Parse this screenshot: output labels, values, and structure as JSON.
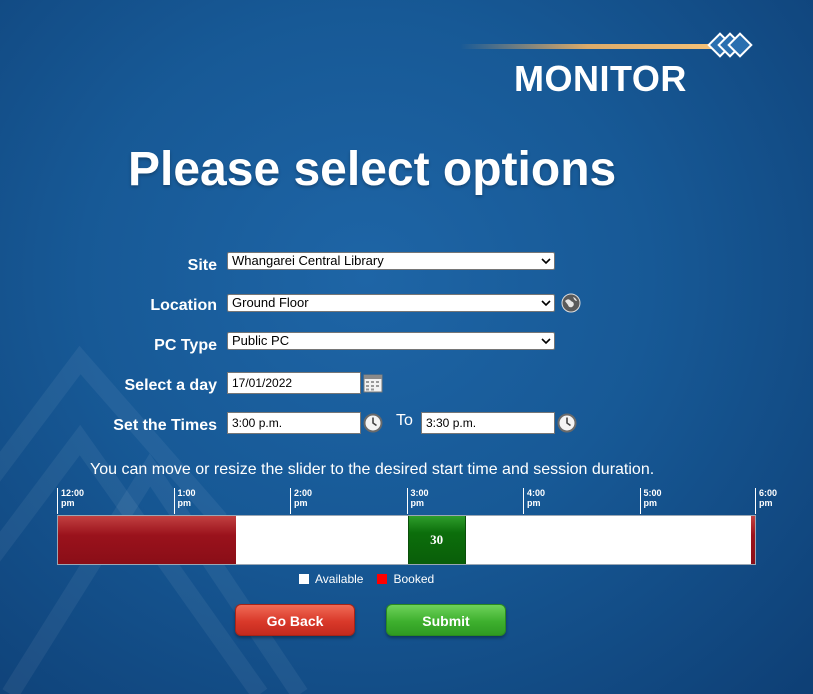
{
  "brand": {
    "logo_text": "MONITOR"
  },
  "page_title": "Please select options",
  "form": {
    "site": {
      "label": "Site",
      "value": "Whangarei Central Library"
    },
    "location": {
      "label": "Location",
      "value": "Ground Floor"
    },
    "pc_type": {
      "label": "PC Type",
      "value": "Public PC"
    },
    "day": {
      "label": "Select a day",
      "value": "17/01/2022"
    },
    "times": {
      "label": "Set the Times",
      "start": "3:00 p.m.",
      "to_label": "To",
      "end": "3:30 p.m."
    }
  },
  "slider": {
    "instruction": "You can move or resize the slider to the desired start time and session duration.",
    "range_hours": [
      12,
      18
    ],
    "ticks": [
      {
        "time": "12:00",
        "ampm": "pm"
      },
      {
        "time": "1:00",
        "ampm": "pm"
      },
      {
        "time": "2:00",
        "ampm": "pm"
      },
      {
        "time": "3:00",
        "ampm": "pm"
      },
      {
        "time": "4:00",
        "ampm": "pm"
      },
      {
        "time": "5:00",
        "ampm": "pm"
      },
      {
        "time": "6:00",
        "ampm": "pm"
      }
    ],
    "booked": [
      {
        "start_hour": 12.0,
        "end_hour": 13.53
      },
      {
        "start_hour": 17.95,
        "end_hour": 18.0
      }
    ],
    "selection": {
      "start_hour": 15.0,
      "end_hour": 15.5,
      "label": "30"
    }
  },
  "legend": {
    "available": {
      "label": "Available",
      "color": "#ffffff"
    },
    "booked": {
      "label": "Booked",
      "color": "#ff0000"
    }
  },
  "buttons": {
    "back": "Go Back",
    "submit": "Submit"
  },
  "icons": {
    "location": "globe-icon",
    "day": "calendar-icon",
    "time": "clock-icon"
  }
}
